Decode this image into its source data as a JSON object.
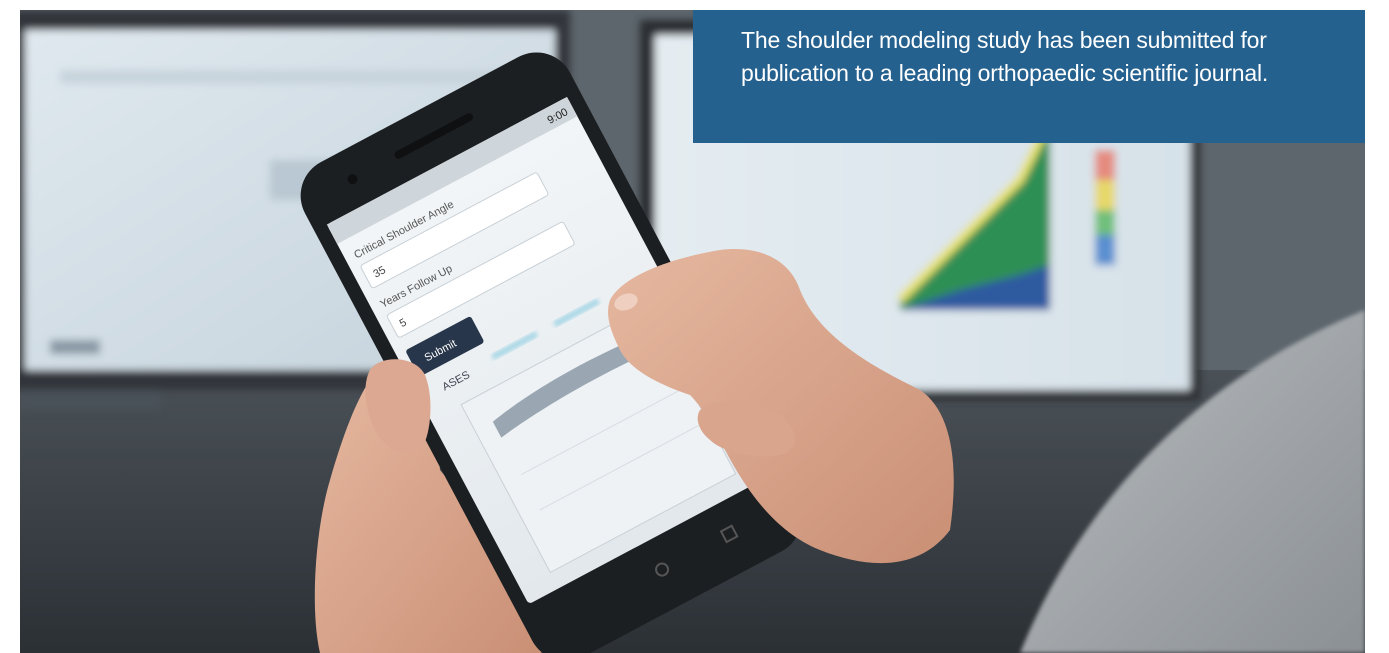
{
  "caption": {
    "text": "The shoulder modeling study has been submitted for publication to a leading orthopaedic scientific journal."
  },
  "phone_screen": {
    "status_time": "9:00",
    "field_1_label": "Critical Shoulder Angle",
    "field_1_value": "35",
    "field_2_label": "Years Follow Up",
    "field_2_value": "5",
    "submit_label": "Submit",
    "tab_ases": "ASES"
  },
  "colors": {
    "caption_bg": "#25618f",
    "caption_text": "#ffffff",
    "phone_body": "#1c1f22",
    "submit_button": "#27364a"
  }
}
